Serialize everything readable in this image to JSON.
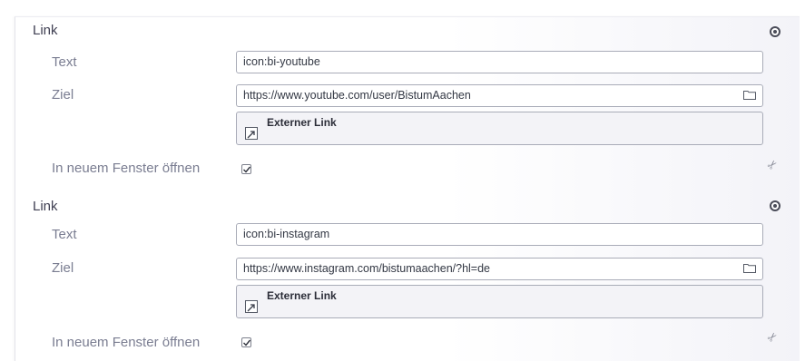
{
  "sections": [
    {
      "title": "Link",
      "text_label": "Text",
      "text_value": "icon:bi-youtube",
      "ziel_label": "Ziel",
      "ziel_value": "https://www.youtube.com/user/BistumAachen",
      "link_type": "Externer Link",
      "newwindow_label": "In neuem Fenster öffnen",
      "newwindow_checked": true
    },
    {
      "title": "Link",
      "text_label": "Text",
      "text_value": "icon:bi-instagram",
      "ziel_label": "Ziel",
      "ziel_value": "https://www.instagram.com/bistumaachen/?hl=de",
      "link_type": "Externer Link",
      "newwindow_label": "In neuem Fenster öffnen",
      "newwindow_checked": true
    }
  ],
  "icons": {
    "collapse": "radio-circle-icon",
    "folder": "folder-icon",
    "external": "external-link-icon",
    "cut": "scissors-icon",
    "check": "checkmark-icon"
  }
}
